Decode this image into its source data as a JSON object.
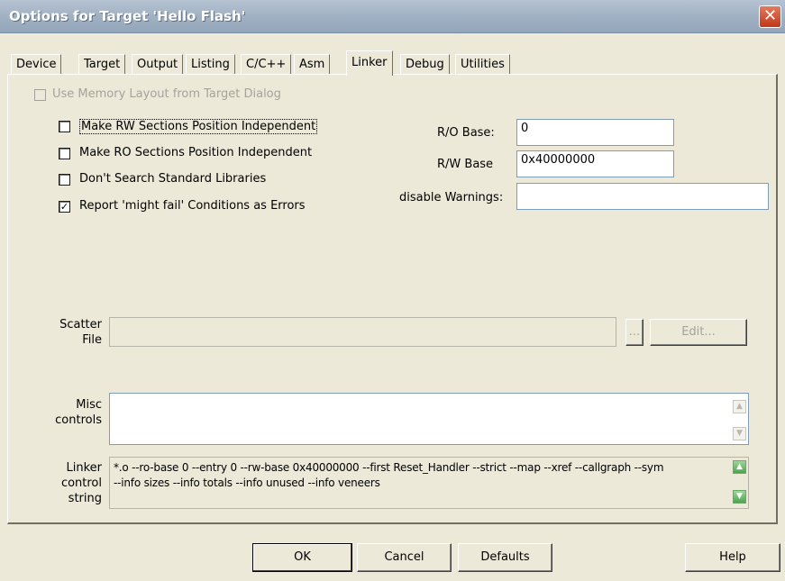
{
  "window": {
    "title": "Options for Target 'Hello Flash'",
    "close_glyph": "✕"
  },
  "tabs": [
    {
      "label": "Device"
    },
    {
      "label": "Target"
    },
    {
      "label": "Output"
    },
    {
      "label": "Listing"
    },
    {
      "label": "C/C++"
    },
    {
      "label": "Asm"
    },
    {
      "label": "Linker"
    },
    {
      "label": "Debug"
    },
    {
      "label": "Utilities"
    }
  ],
  "active_tab": "Linker",
  "use_memory_layout": {
    "label": "Use Memory Layout from Target Dialog",
    "checked": false,
    "enabled": false
  },
  "options": [
    {
      "label": "Make RW Sections Position Independent",
      "checked": false
    },
    {
      "label": "Make RO Sections Position Independent",
      "checked": false
    },
    {
      "label": "Don't Search Standard Libraries",
      "checked": false
    },
    {
      "label": "Report 'might fail' Conditions as Errors",
      "checked": true
    }
  ],
  "ro_base": {
    "label": "R/O Base:",
    "value": "0"
  },
  "rw_base": {
    "label": "R/W Base",
    "value": "0x40000000"
  },
  "disable_warnings": {
    "label": "disable Warnings:",
    "value": ""
  },
  "scatter_file": {
    "label_line1": "Scatter",
    "label_line2": "File",
    "value": "",
    "browse_label": "...",
    "edit_label": "Edit..."
  },
  "misc_controls": {
    "label_line1": "Misc",
    "label_line2": "controls",
    "value": ""
  },
  "linker_control_string": {
    "label_line1": "Linker",
    "label_line2": "control",
    "label_line3": "string",
    "line1": "*.o --ro-base 0 --entry 0 --rw-base 0x40000000 --first Reset_Handler --strict --map --xref --callgraph --sym",
    "line2": "--info sizes --info totals --info unused --info veneers"
  },
  "buttons": {
    "ok": "OK",
    "cancel": "Cancel",
    "defaults": "Defaults",
    "help": "Help"
  },
  "colors": {
    "dialog_bg": "#ece9d8",
    "title_gradient": "#a3b3c5",
    "close_button": "#c2371a"
  },
  "icons": {
    "close": "close-icon",
    "check": "check-icon",
    "scroll_up": "scroll-up-icon",
    "scroll_down": "scroll-down-icon"
  }
}
